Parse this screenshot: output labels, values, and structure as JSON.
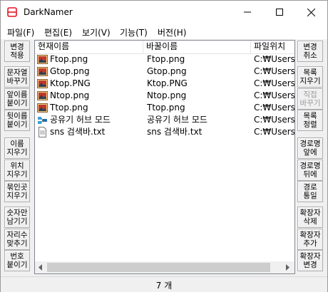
{
  "window": {
    "title": "DarkNamer",
    "minimize_glyph": "—",
    "maximize_glyph": "☐",
    "close_glyph": "✕"
  },
  "menu": [
    "파일(F)",
    "편집(E)",
    "보기(V)",
    "기능(T)",
    "버전(H)"
  ],
  "left_buttons": [
    {
      "label": "변경\n적용",
      "enabled": true
    },
    {
      "label": "문자열\n바꾸기",
      "enabled": true
    },
    {
      "label": "앞이름\n붙이기",
      "enabled": true
    },
    {
      "label": "뒷이름\n붙이기",
      "enabled": true
    },
    {
      "label": "이름\n지우기",
      "enabled": true
    },
    {
      "label": "위치\n지우기",
      "enabled": true
    },
    {
      "label": "묶인곳\n지우기",
      "enabled": true
    },
    {
      "label": "숫자만\n남기기",
      "enabled": true
    },
    {
      "label": "자리수\n맞추기",
      "enabled": true
    },
    {
      "label": "번호\n붙이기",
      "enabled": true
    }
  ],
  "right_buttons": [
    {
      "label": "변경\n취소",
      "enabled": true
    },
    {
      "label": "목록\n지우기",
      "enabled": true
    },
    {
      "label": "직접\n바꾸기",
      "enabled": false
    },
    {
      "label": "목록\n정렬",
      "enabled": true
    },
    {
      "label": "경로명\n앞에",
      "enabled": true
    },
    {
      "label": "경로명\n뒤에",
      "enabled": true
    },
    {
      "label": "경로\n통일",
      "enabled": true
    },
    {
      "label": "확장자\n삭제",
      "enabled": true
    },
    {
      "label": "확장자\n추가",
      "enabled": true
    },
    {
      "label": "확장자\n변경",
      "enabled": true
    }
  ],
  "columns": [
    "현재이름",
    "바꿀이름",
    "파일위치"
  ],
  "files": [
    {
      "current": "Ftop.png",
      "new": "Ftop.png",
      "location": "C:₩Users",
      "icon": "image-file-icon"
    },
    {
      "current": "Gtop.png",
      "new": "Gtop.png",
      "location": "C:₩Users",
      "icon": "image-file-icon"
    },
    {
      "current": "Ktop.PNG",
      "new": "Ktop.PNG",
      "location": "C:₩Users",
      "icon": "image-file-icon"
    },
    {
      "current": "Ntop.png",
      "new": "Ntop.png",
      "location": "C:₩Users",
      "icon": "image-file-icon"
    },
    {
      "current": "Ttop.png",
      "new": "Ttop.png",
      "location": "C:₩Users",
      "icon": "image-file-icon"
    },
    {
      "current": "공유기 허브 모드",
      "new": "공유기 허브 모드",
      "location": "C:₩Users",
      "icon": "network-shortcut-icon"
    },
    {
      "current": "sns 검색바.txt",
      "new": "sns 검색바.txt",
      "location": "C:₩Users",
      "icon": "text-file-icon"
    }
  ],
  "status": "7 개",
  "colors": {
    "accent_red": "#e81123",
    "border": "#828790",
    "scroll_thumb": "#cdcdcd"
  }
}
